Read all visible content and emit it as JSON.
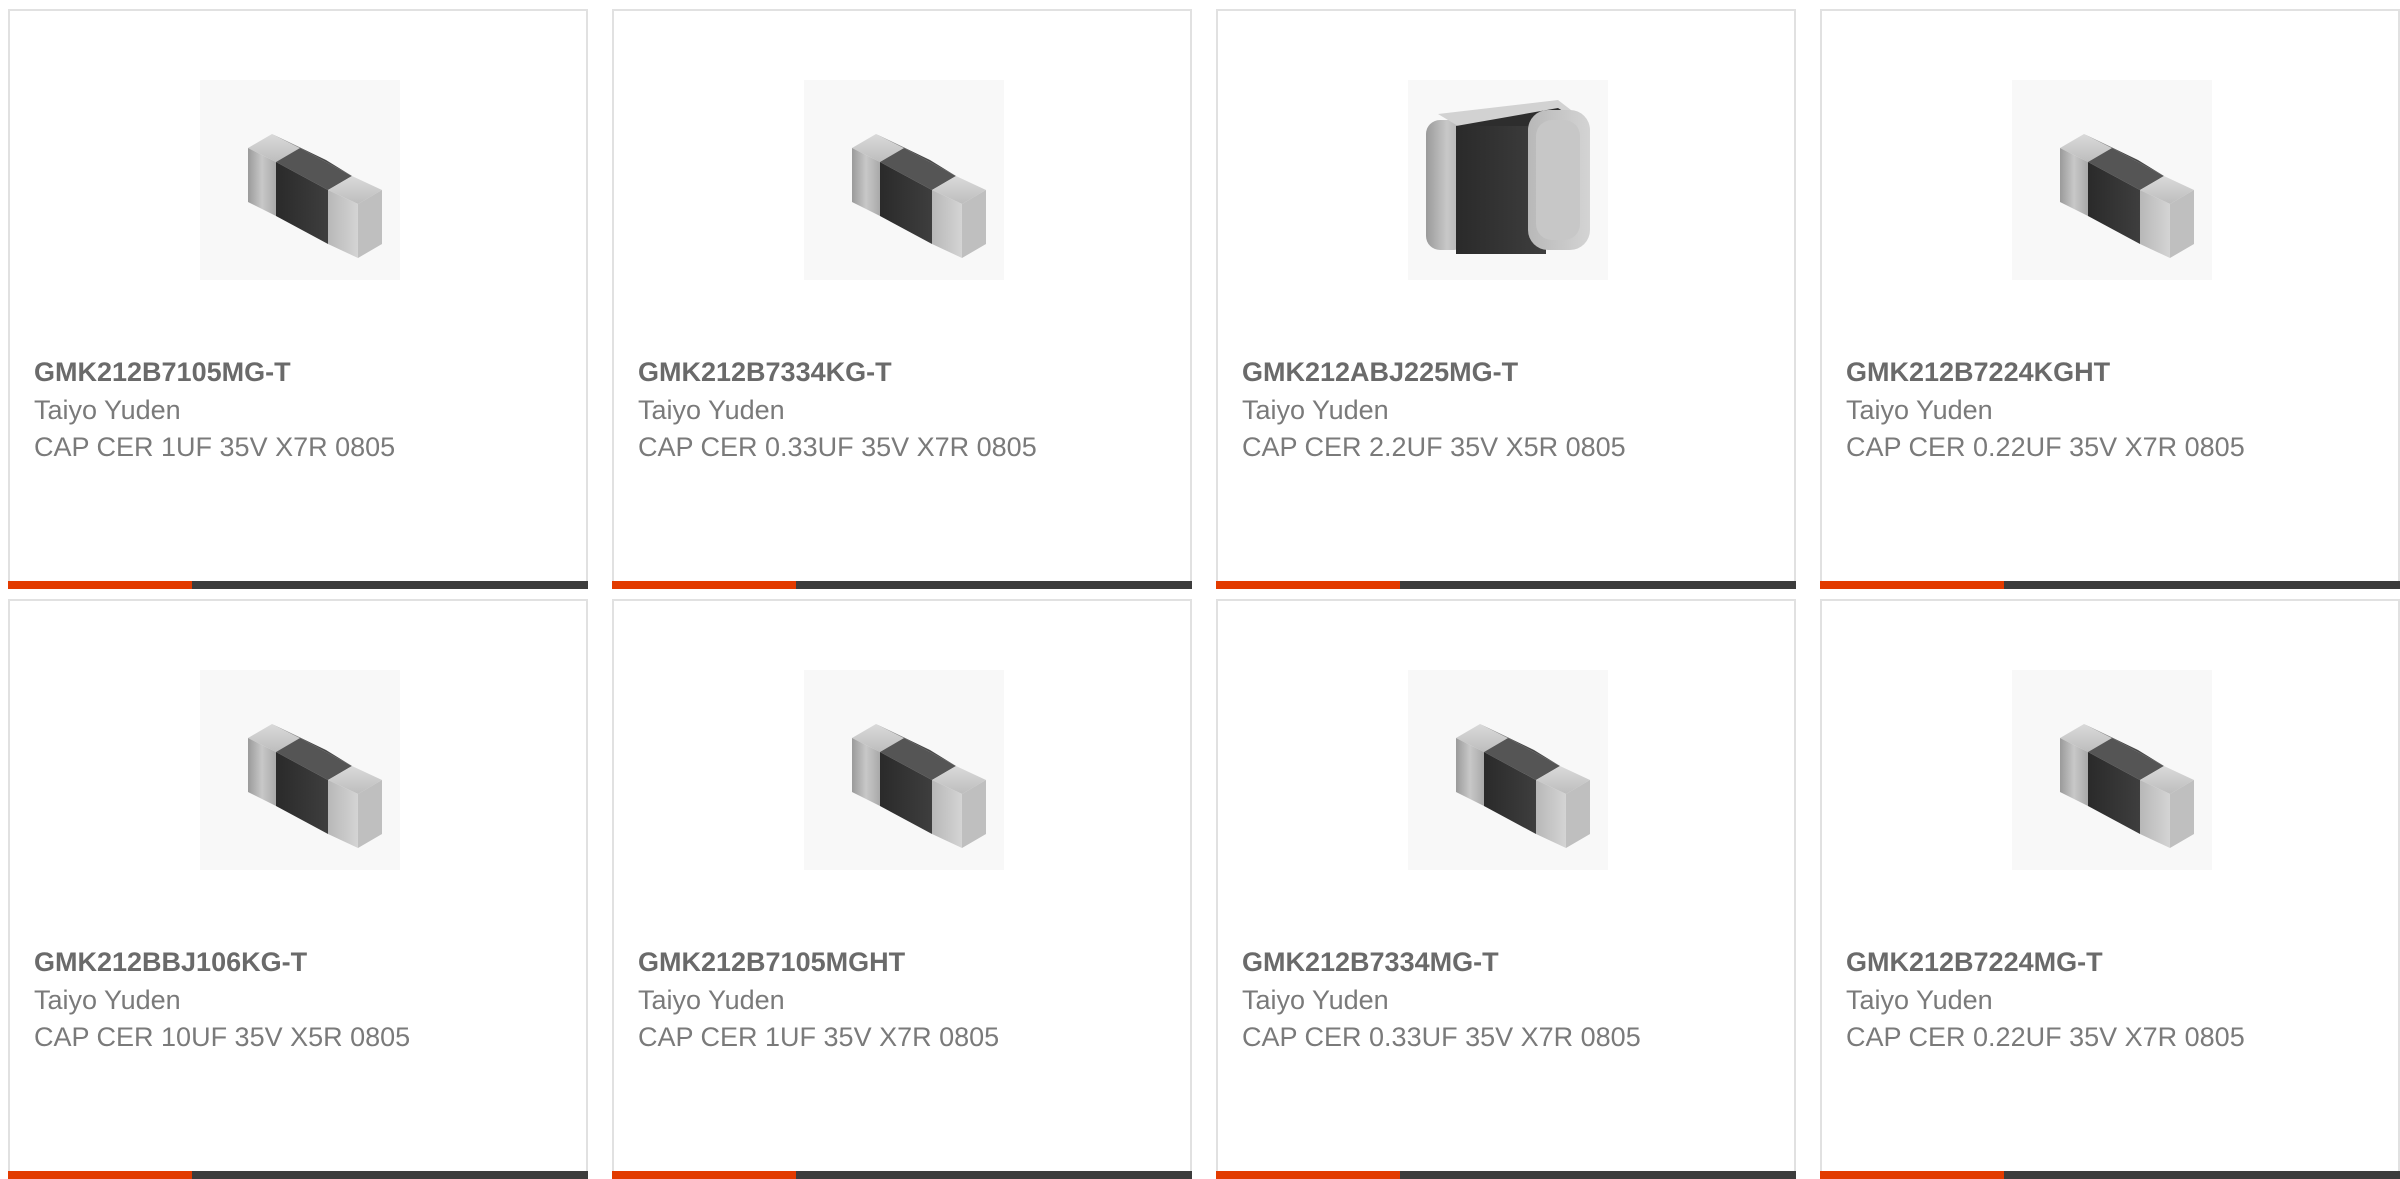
{
  "colors": {
    "accent": "#e23b00",
    "bar_dark": "#3c3c3c",
    "card_border": "#e1e1e1",
    "text": "#7a7a7a"
  },
  "products": [
    {
      "part_number": "GMK212B7105MG-T",
      "manufacturer": "Taiyo Yuden",
      "description": "CAP CER 1UF 35V X7R 0805",
      "image_icon": "ceramic-capacitor-chip-icon"
    },
    {
      "part_number": "GMK212B7334KG-T",
      "manufacturer": "Taiyo Yuden",
      "description": "CAP CER 0.33UF 35V X7R 0805",
      "image_icon": "ceramic-capacitor-chip-icon"
    },
    {
      "part_number": "GMK212ABJ225MG-T",
      "manufacturer": "Taiyo Yuden",
      "description": "CAP CER 2.2UF 35V X5R 0805",
      "image_icon": "ceramic-capacitor-chip-icon"
    },
    {
      "part_number": "GMK212B7224KGHT",
      "manufacturer": "Taiyo Yuden",
      "description": "CAP CER 0.22UF 35V X7R 0805",
      "image_icon": "ceramic-capacitor-chip-icon"
    },
    {
      "part_number": "GMK212BBJ106KG-T",
      "manufacturer": "Taiyo Yuden",
      "description": "CAP CER 10UF 35V X5R 0805",
      "image_icon": "ceramic-capacitor-chip-icon"
    },
    {
      "part_number": "GMK212B7105MGHT",
      "manufacturer": "Taiyo Yuden",
      "description": "CAP CER 1UF 35V X7R 0805",
      "image_icon": "ceramic-capacitor-chip-icon"
    },
    {
      "part_number": "GMK212B7334MG-T",
      "manufacturer": "Taiyo Yuden",
      "description": "CAP CER 0.33UF 35V X7R 0805",
      "image_icon": "ceramic-capacitor-chip-icon"
    },
    {
      "part_number": "GMK212B7224MG-T",
      "manufacturer": "Taiyo Yuden",
      "description": "CAP CER 0.22UF 35V X7R 0805",
      "image_icon": "ceramic-capacitor-chip-icon"
    }
  ]
}
